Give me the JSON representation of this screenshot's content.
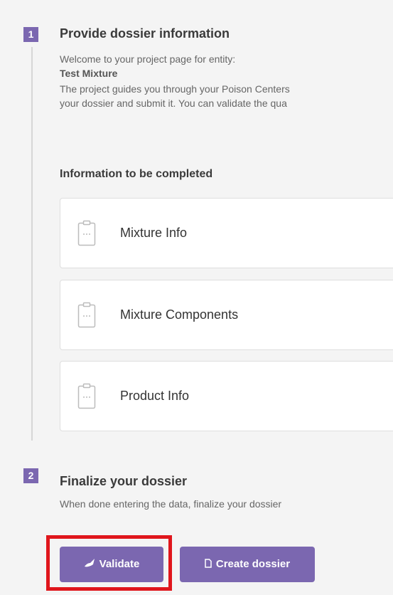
{
  "step1": {
    "number": "1",
    "title": "Provide dossier information",
    "desc_line1": "Welcome to your project page for entity:",
    "entity_name": "Test Mixture",
    "desc_line3": "The project guides you through your Poison Centers",
    "desc_line4": "your dossier and submit it. You can validate the qua",
    "section_heading": "Information to be completed",
    "cards": [
      {
        "label": "Mixture Info",
        "icon": "clipboard-icon"
      },
      {
        "label": "Mixture Components",
        "icon": "clipboard-icon"
      },
      {
        "label": "Product Info",
        "icon": "clipboard-icon"
      }
    ]
  },
  "step2": {
    "number": "2",
    "title": "Finalize your dossier",
    "desc": "When done entering the data, finalize your dossier",
    "buttons": {
      "validate_label": "Validate",
      "validate_icon": "brush-icon",
      "create_label": "Create dossier",
      "create_icon": "document-icon"
    }
  },
  "colors": {
    "accent": "#7b67b0",
    "highlight": "#e0161c"
  }
}
